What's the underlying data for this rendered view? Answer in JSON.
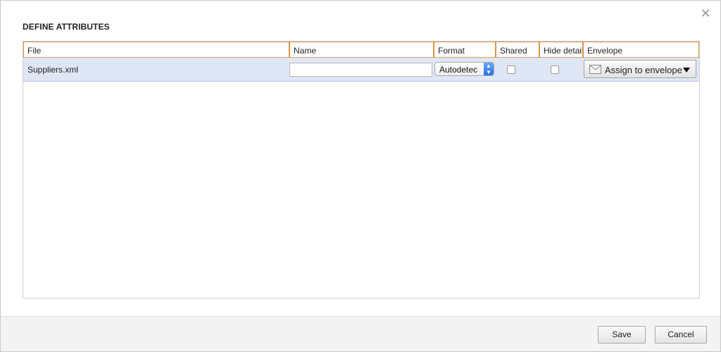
{
  "dialog": {
    "title": "DEFINE ATTRIBUTES",
    "close_icon": "close-icon"
  },
  "table": {
    "columns": [
      "File",
      "Name",
      "Format",
      "Shared",
      "Hide details",
      "Envelope"
    ],
    "rows": [
      {
        "file": "Suppliers.xml",
        "name_value": "",
        "format": "Autodetec",
        "shared": false,
        "hide_details": false,
        "envelope_label": "Assign to envelope",
        "envelope_icon": "envelope-icon"
      }
    ]
  },
  "footer": {
    "save_label": "Save",
    "cancel_label": "Cancel"
  },
  "colors": {
    "header_border": "#e3913f",
    "selected_row": "#dfe6f5",
    "select_arrow": "#2a72e6"
  }
}
